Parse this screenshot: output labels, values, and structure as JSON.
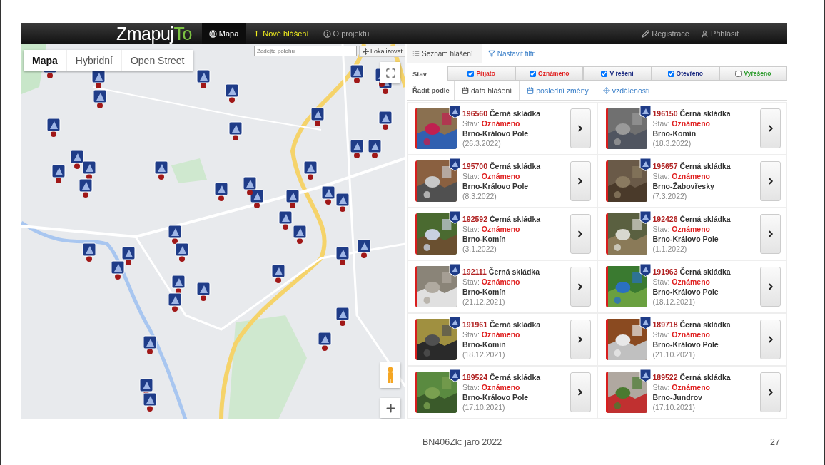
{
  "navbar": {
    "logo": {
      "text": "Zmapuj",
      "accent": "To"
    },
    "items": [
      {
        "label": "Mapa",
        "kind": "plain",
        "selected": true
      },
      {
        "label": "Nové hlášení",
        "kind": "accent",
        "selected": false
      },
      {
        "label": "O projektu",
        "kind": "plain",
        "selected": false
      }
    ],
    "right_items": [
      {
        "label": "Registrace"
      },
      {
        "label": "Přihlásit"
      }
    ]
  },
  "map": {
    "map_types": [
      {
        "label": "Mapa",
        "selected": true
      },
      {
        "label": "Hybridní",
        "selected": false
      },
      {
        "label": "Open Street",
        "selected": false
      }
    ],
    "search": {
      "placeholder": "Zadejte polohu"
    },
    "locate_button": "Lokalizovat"
  },
  "panel": {
    "tabs": [
      {
        "label": "Seznam hlášení",
        "selected": true
      },
      {
        "label": "Nastavit filtr",
        "selected": false
      }
    ],
    "status_filter": {
      "label": "Stav",
      "options": [
        {
          "label": "Přijato",
          "checked": true,
          "color": "#e02020"
        },
        {
          "label": "Oznámeno",
          "checked": true,
          "color": "#e02020"
        },
        {
          "label": "V řešení",
          "checked": true,
          "color": "#1a2a80"
        },
        {
          "label": "Otevřeno",
          "checked": true,
          "color": "#1a2a80"
        },
        {
          "label": "Vyřešeno",
          "checked": false,
          "color": "#2a9a2a"
        }
      ]
    },
    "sort": {
      "label": "Řadit podle",
      "options": [
        {
          "label": "data hlášení",
          "selected": true
        },
        {
          "label": "poslední změny",
          "selected": false
        },
        {
          "label": "vzdálenosti",
          "selected": false
        }
      ]
    },
    "reports": [
      {
        "id": "196560",
        "title": "Černá skládka",
        "status_label": "Stav:",
        "status": "Oznámeno",
        "place": "Brno-Královo Pole",
        "date": "(26.3.2022)"
      },
      {
        "id": "196150",
        "title": "Černá skládka",
        "status_label": "Stav:",
        "status": "Oznámeno",
        "place": "Brno-Komín",
        "date": "(18.3.2022)"
      },
      {
        "id": "195700",
        "title": "Černá skládka",
        "status_label": "Stav:",
        "status": "Oznámeno",
        "place": "Brno-Královo Pole",
        "date": "(8.3.2022)"
      },
      {
        "id": "195657",
        "title": "Černá skládka",
        "status_label": "Stav:",
        "status": "Oznámeno",
        "place": "Brno-Žabovřesky",
        "date": "(7.3.2022)"
      },
      {
        "id": "192592",
        "title": "Černá skládka",
        "status_label": "Stav:",
        "status": "Oznámeno",
        "place": "Brno-Komín",
        "date": "(3.1.2022)"
      },
      {
        "id": "192426",
        "title": "Černá skládka",
        "status_label": "Stav:",
        "status": "Oznámeno",
        "place": "Brno-Královo Pole",
        "date": "(1.1.2022)"
      },
      {
        "id": "192111",
        "title": "Černá skládka",
        "status_label": "Stav:",
        "status": "Oznámeno",
        "place": "Brno-Komín",
        "date": "(21.12.2021)"
      },
      {
        "id": "191963",
        "title": "Černá skládka",
        "status_label": "Stav:",
        "status": "Oznámeno",
        "place": "Brno-Královo Pole",
        "date": "(18.12.2021)"
      },
      {
        "id": "191961",
        "title": "Černá skládka",
        "status_label": "Stav:",
        "status": "Oznámeno",
        "place": "Brno-Komín",
        "date": "(18.12.2021)"
      },
      {
        "id": "189718",
        "title": "Černá skládka",
        "status_label": "Stav:",
        "status": "Oznámeno",
        "place": "Brno-Královo Pole",
        "date": "(21.10.2021)"
      },
      {
        "id": "189524",
        "title": "Černá skládka",
        "status_label": "Stav:",
        "status": "Oznámeno",
        "place": "Brno-Královo Pole",
        "date": "(17.10.2021)"
      },
      {
        "id": "189522",
        "title": "Černá skládka",
        "status_label": "Stav:",
        "status": "Oznámeno",
        "place": "Brno-Jundrov",
        "date": "(17.10.2021)"
      }
    ]
  },
  "footer": {
    "course": "BN406Zk: jaro 2022",
    "page": "27"
  }
}
